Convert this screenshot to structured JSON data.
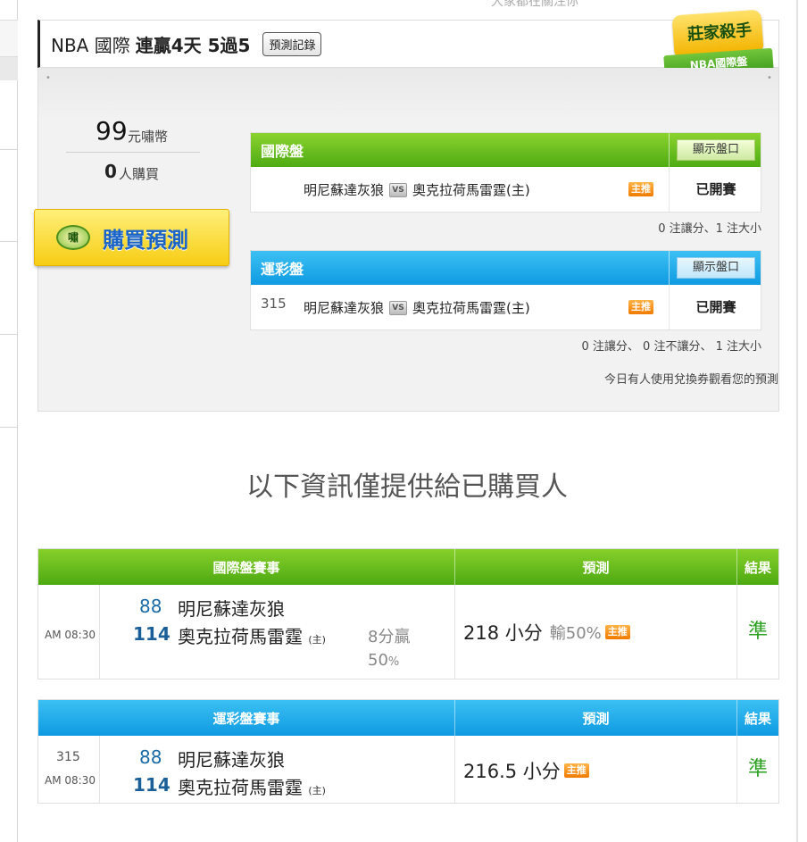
{
  "top_note": "大家都在關注你",
  "header": {
    "league": "NBA 國際",
    "streak": "連贏4天 5過5",
    "record_button": "預測記錄",
    "badge_title": "莊家殺手",
    "badge_ribbon": "NBA國際盤"
  },
  "pricing": {
    "price": "99",
    "price_unit": "元嘯幣",
    "buyers": "0",
    "buyers_unit": "人購買",
    "buy_button": "購買預測",
    "coin_label": "嘯"
  },
  "intl_odds": {
    "title": "國際盤",
    "show_button": "顯示盤口",
    "number": "",
    "away": "明尼蘇達灰狼",
    "vs": "VS",
    "home": "奧克拉荷馬雷霆(主)",
    "tag": "主推",
    "status": "已開賽",
    "note": "0 注讓分、1 注大小"
  },
  "lottery_odds": {
    "title": "運彩盤",
    "show_button": "顯示盤口",
    "number": "315",
    "away": "明尼蘇達灰狼",
    "vs": "VS",
    "home": "奧克拉荷馬雷霆(主)",
    "tag": "主推",
    "status": "已開賽",
    "note": "0 注讓分、 0 注不讓分、 1 注大小"
  },
  "voucher_note": "今日有人使用兌換券觀看您的預測",
  "purchaser_heading": "以下資訊僅提供給已購買人",
  "intl_results": {
    "col_match": "國際盤賽事",
    "col_pred": "預測",
    "col_result": "結果",
    "time": "AM 08:30",
    "away_score": "88",
    "away_name": "明尼蘇達灰狼",
    "home_score": "114",
    "home_name": "奧克拉荷馬雷霆",
    "home_mark": "(主)",
    "handicap_line1": "8分贏",
    "handicap_pct": "50",
    "handicap_pct_unit": "%",
    "prediction": "218 小分",
    "prediction_extra": "輸50%",
    "tag": "主推",
    "result": "準"
  },
  "lottery_results": {
    "col_match": "運彩盤賽事",
    "col_pred": "預測",
    "col_result": "結果",
    "number": "315",
    "time": "AM 08:30",
    "away_score": "88",
    "away_name": "明尼蘇達灰狼",
    "home_score": "114",
    "home_name": "奧克拉荷馬雷霆",
    "home_mark": "(主)",
    "prediction": "216.5 小分",
    "tag": "主推",
    "result": "準"
  }
}
